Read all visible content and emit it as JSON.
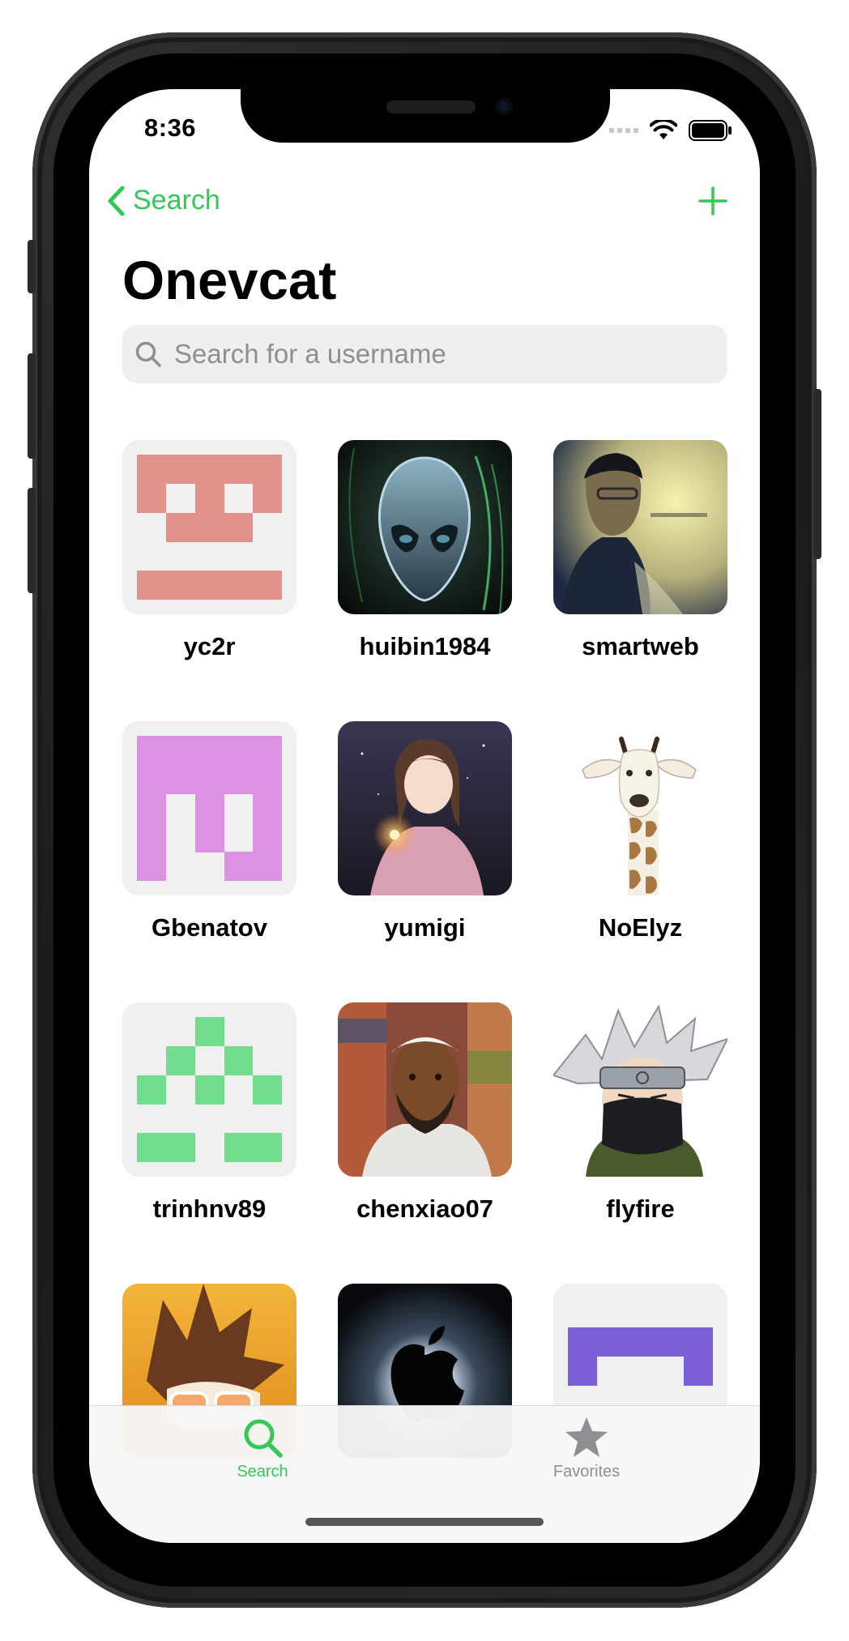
{
  "status_bar": {
    "time": "8:36"
  },
  "nav": {
    "back_label": "Search",
    "title": "Onevcat"
  },
  "search": {
    "placeholder": "Search for a username"
  },
  "colors": {
    "accent": "#34c759",
    "inactive": "#8e8e93"
  },
  "users": [
    {
      "username": "yc2r",
      "avatar": "identicon-salmon"
    },
    {
      "username": "huibin1984",
      "avatar": "alien-photo"
    },
    {
      "username": "smartweb",
      "avatar": "portrait-photo"
    },
    {
      "username": "Gbenatov",
      "avatar": "identicon-pink"
    },
    {
      "username": "yumigi",
      "avatar": "anime-photo"
    },
    {
      "username": "NoElyz",
      "avatar": "giraffe-illustration"
    },
    {
      "username": "trinhnv89",
      "avatar": "identicon-green"
    },
    {
      "username": "chenxiao07",
      "avatar": "portrait-photo"
    },
    {
      "username": "flyfire",
      "avatar": "ninja-illustration"
    },
    {
      "username": "",
      "avatar": "cartoon-illustration"
    },
    {
      "username": "",
      "avatar": "apple-logo-photo"
    },
    {
      "username": "",
      "avatar": "identicon-purple"
    }
  ],
  "tabs": [
    {
      "label": "Search",
      "icon": "search-icon",
      "active": true
    },
    {
      "label": "Favorites",
      "icon": "star-icon",
      "active": false
    }
  ]
}
